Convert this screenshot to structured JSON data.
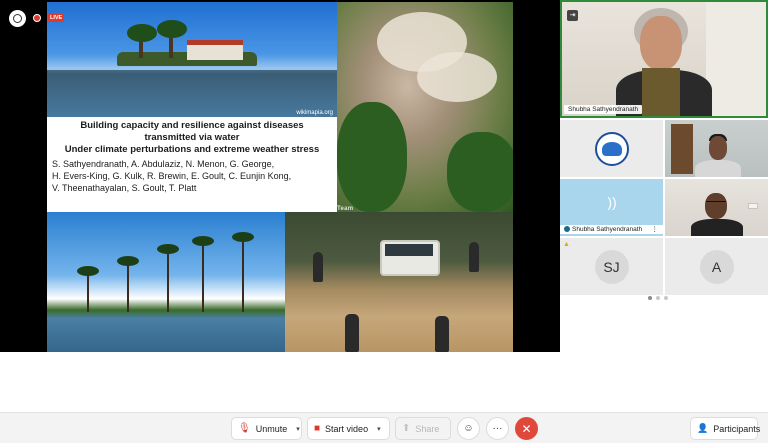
{
  "slide": {
    "photo_credit": "wikimapia.org",
    "title": "Building capacity and resilience against diseases\ntransmitted via water\nUnder climate perturbations and extreme weather stress",
    "authors": "S. Sathyendranath, A. Abdulaziz, N. Menon, G. George,\nH. Evers-King, G. Kulk, R. Brewin, E. Goult, C. Eunjin Kong,\nV. Theenathayalan, S. Goult, T. Platt",
    "photo_tag": "Team"
  },
  "overlay": {
    "rec_badge": "LIVE"
  },
  "participants": {
    "speaker_name": "Shubha Sathyendranath",
    "audio_tile_name": "Shubha Sathyendranath",
    "audio_tile_more": "⋮",
    "initials_1": "SJ",
    "initials_2": "A"
  },
  "toolbar": {
    "unmute_label": "Unmute",
    "start_video_label": "Start video",
    "share_label": "Share",
    "more_label": "···",
    "participants_label": "Participants"
  },
  "icons": {
    "mic_muted": "mic-off-icon",
    "video_off": "video-off-icon",
    "share": "share-icon",
    "reactions": "emoji-icon",
    "more": "more-icon",
    "leave": "close-icon",
    "participants": "people-icon"
  },
  "colors": {
    "leave_red": "#e0483c",
    "active_speaker_border": "#2f8a3a",
    "muted_red": "#e0362b"
  }
}
